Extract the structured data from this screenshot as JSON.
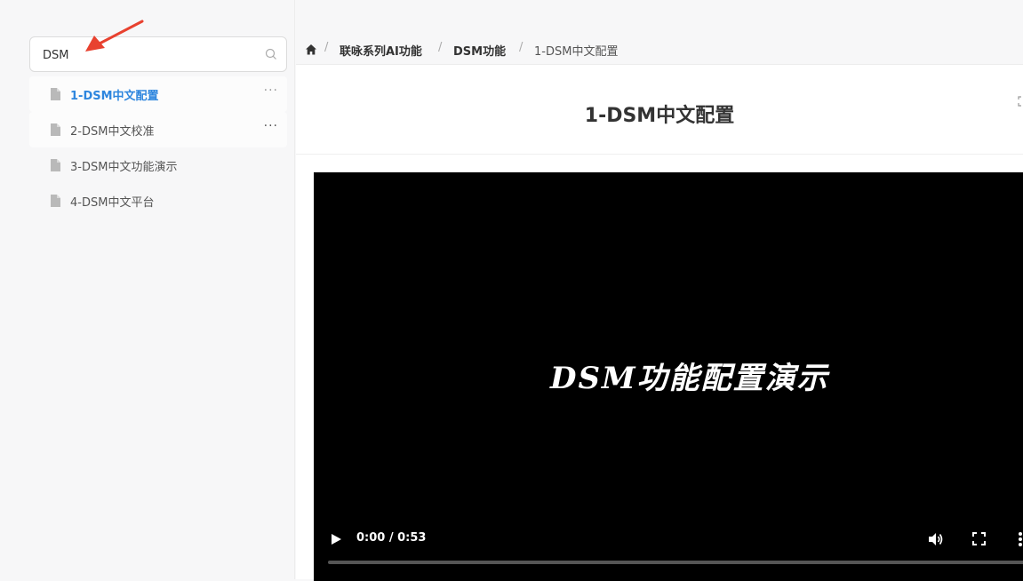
{
  "search": {
    "value": "DSM"
  },
  "tree": {
    "items": [
      {
        "label": "1-DSM中文配置",
        "more": "···"
      },
      {
        "label": "2-DSM中文校准",
        "more": "···"
      },
      {
        "label": "3-DSM中文功能演示"
      },
      {
        "label": "4-DSM中文平台"
      }
    ]
  },
  "breadcrumb": {
    "items": [
      "联咏系列AI功能",
      "DSM功能",
      "1-DSM中文配置"
    ],
    "separator": "/"
  },
  "page": {
    "title": "1-DSM中文配置"
  },
  "video": {
    "overlay_text": "DSM功能配置演示",
    "time": "0:00 / 0:53",
    "progress": 0.0
  },
  "colors": {
    "accent": "#2e86de",
    "arrow": "#e8412f"
  }
}
